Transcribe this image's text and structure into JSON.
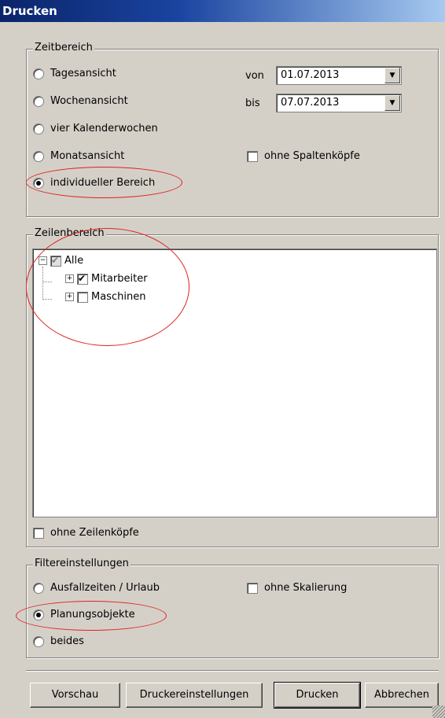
{
  "window": {
    "title": "Drucken"
  },
  "zeitbereich": {
    "legend": "Zeitbereich",
    "options": [
      {
        "label": "Tagesansicht",
        "selected": false
      },
      {
        "label": "Wochenansicht",
        "selected": false
      },
      {
        "label": "vier Kalenderwochen",
        "selected": false
      },
      {
        "label": "Monatsansicht",
        "selected": false
      },
      {
        "label": "individueller Bereich",
        "selected": true
      }
    ],
    "von_label": "von",
    "von_value": "01.07.2013",
    "bis_label": "bis",
    "bis_value": "07.07.2013",
    "ohne_spaltenkoepfe_label": "ohne Spaltenköpfe",
    "ohne_spaltenkoepfe_checked": false
  },
  "zeilenbereich": {
    "legend": "Zeilenbereich",
    "tree": [
      {
        "label": "Alle",
        "checked": true,
        "greyed": true,
        "expanded": true
      },
      {
        "label": "Mitarbeiter",
        "checked": true,
        "expanded": false
      },
      {
        "label": "Maschinen",
        "checked": false,
        "expanded": false
      }
    ],
    "ohne_zeilenkoepfe_label": "ohne Zeilenköpfe",
    "ohne_zeilenkoepfe_checked": false
  },
  "filter": {
    "legend": "Filtereinstellungen",
    "options": [
      {
        "label": "Ausfallzeiten / Urlaub",
        "selected": false
      },
      {
        "label": "Planungsobjekte",
        "selected": true
      },
      {
        "label": "beides",
        "selected": false
      }
    ],
    "ohne_skalierung_label": "ohne Skalierung",
    "ohne_skalierung_checked": false
  },
  "buttons": {
    "vorschau": "Vorschau",
    "druckereinstellungen": "Druckereinstellungen",
    "drucken": "Drucken",
    "abbrechen": "Abbrechen"
  },
  "colors": {
    "annotation": "#e02020",
    "titlebar": "#0a246a",
    "face": "#d4d0c8"
  }
}
